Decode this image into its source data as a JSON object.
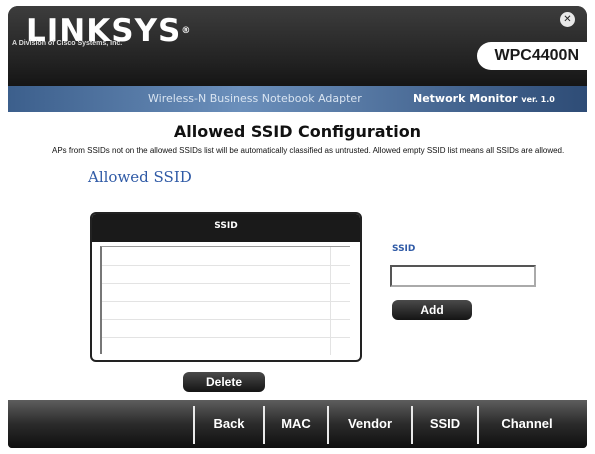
{
  "header": {
    "brand": "LINKSYS",
    "brand_mark": "®",
    "brand_sub": "A Division of Cisco Systems, Inc.",
    "model": "WPC4400N",
    "close_glyph": "✕"
  },
  "subheader": {
    "product": "Wireless-N Business Notebook Adapter",
    "app": "Network Monitor",
    "version": "ver. 1.0"
  },
  "main": {
    "title": "Allowed SSID Configuration",
    "description": "APs from SSIDs not on the allowed SSIDs list will be automatically classified as untrusted. Allowed empty SSID list means all SSIDs are allowed.",
    "section_title": "Allowed SSID",
    "list_header": "SSID",
    "ssid_label": "SSID",
    "ssid_value": "",
    "add_label": "Add",
    "delete_label": "Delete"
  },
  "footer": {
    "nav": [
      "Back",
      "MAC",
      "Vendor",
      "SSID",
      "Channel"
    ]
  }
}
